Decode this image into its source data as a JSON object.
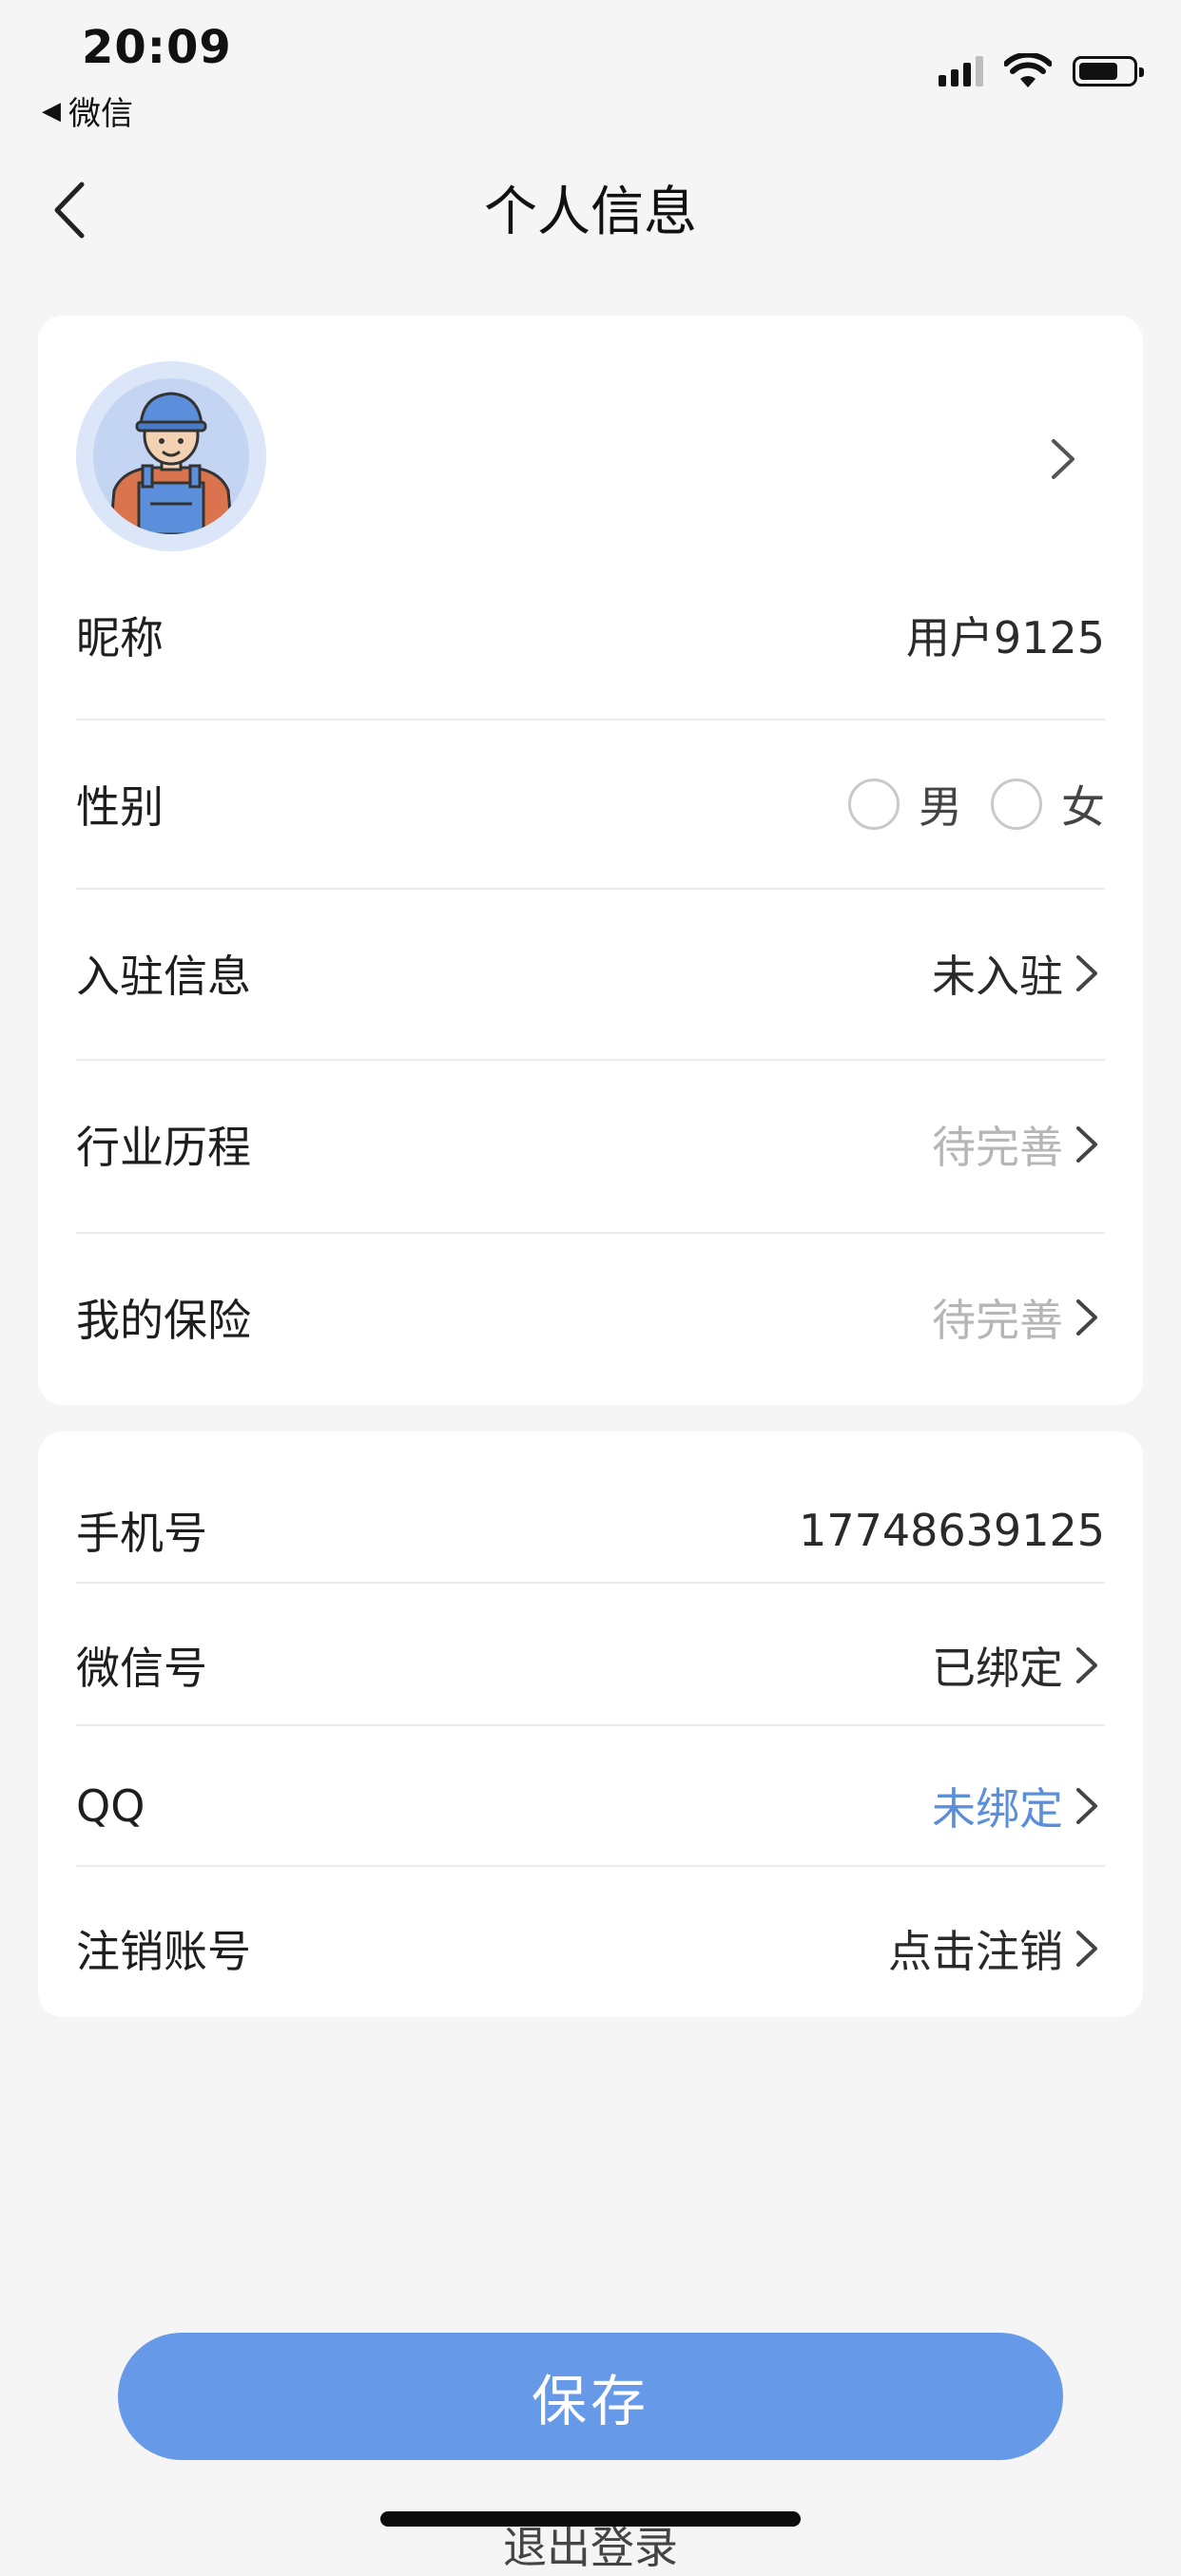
{
  "status_bar": {
    "time": "20:09",
    "back_app": "微信",
    "back_icon": "triangle-left-icon",
    "icons": [
      "signal-icon",
      "wifi-icon",
      "battery-icon"
    ]
  },
  "nav": {
    "title": "个人信息",
    "back_icon": "chevron-left-icon"
  },
  "profile": {
    "avatar_icon": "worker-avatar-icon",
    "nickname_label": "昵称",
    "nickname_value": "用户9125",
    "gender_label": "性别",
    "gender_options": [
      "男",
      "女"
    ],
    "settle_label": "入驻信息",
    "settle_value": "未入驻",
    "industry_label": "行业历程",
    "industry_value": "待完善",
    "insurance_label": "我的保险",
    "insurance_value": "待完善"
  },
  "account": {
    "phone_label": "手机号",
    "phone_value": "17748639125",
    "wechat_label": "微信号",
    "wechat_value": "已绑定",
    "qq_label": "QQ",
    "qq_value": "未绑定",
    "cancel_label": "注销账号",
    "cancel_value": "点击注销"
  },
  "actions": {
    "save_label": "保存",
    "logout_label": "退出登录"
  },
  "colors": {
    "accent": "#6699e8",
    "link": "#5b8fdb",
    "placeholder": "#b6b6b6",
    "background": "#f5f5f5"
  }
}
